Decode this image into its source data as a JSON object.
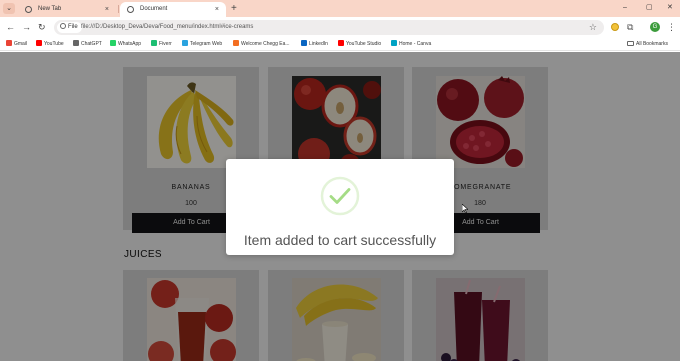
{
  "browser": {
    "tabs": [
      {
        "label": "New Tab",
        "close": "×"
      },
      {
        "label": "Document",
        "close": "×"
      }
    ],
    "tab_menu_glyph": "⌄",
    "new_tab_glyph": "+",
    "window_controls": {
      "minimize": "–",
      "maximize": "▢",
      "close": "✕"
    },
    "nav": {
      "back": "←",
      "forward": "→",
      "reload": "↻"
    },
    "site_chip": "File",
    "url": "file:///D:/Desktop_Deva/Deva/Food_menu/index.html#ice-creams",
    "star_glyph": "☆",
    "extensions_glyph": "⧉",
    "profile_initial": "G",
    "menu_glyph": "⋮",
    "bookmarks": [
      {
        "label": "Gmail",
        "color": "#ea4335"
      },
      {
        "label": "YouTube",
        "color": "#ff0000"
      },
      {
        "label": "ChatGPT",
        "color": "#666666"
      },
      {
        "label": "WhatsApp",
        "color": "#25d366"
      },
      {
        "label": "Fiverr",
        "color": "#1dbf73"
      },
      {
        "label": "Telegram Web",
        "color": "#2aa3df"
      },
      {
        "label": "Welcome Chegg Ea...",
        "color": "#f36e21"
      },
      {
        "label": "LinkedIn",
        "color": "#0a66c2"
      },
      {
        "label": "YouTube Studio",
        "color": "#ff0000"
      },
      {
        "label": "Home - Canva",
        "color": "#00a3c4"
      }
    ],
    "all_bookmarks": "All Bookmarks"
  },
  "page": {
    "fruits": [
      {
        "name": "BANANAS",
        "price": "100",
        "button": "Add To Cart"
      },
      {
        "name": "",
        "price": "",
        "button": ""
      },
      {
        "name": "POMEGRANATE",
        "price": "180",
        "button": "Add To Cart"
      }
    ],
    "juices_title": "JUICES"
  },
  "modal": {
    "message": "Item added to cart successfully",
    "icon": "check-icon",
    "accent": "#a5dc86"
  }
}
